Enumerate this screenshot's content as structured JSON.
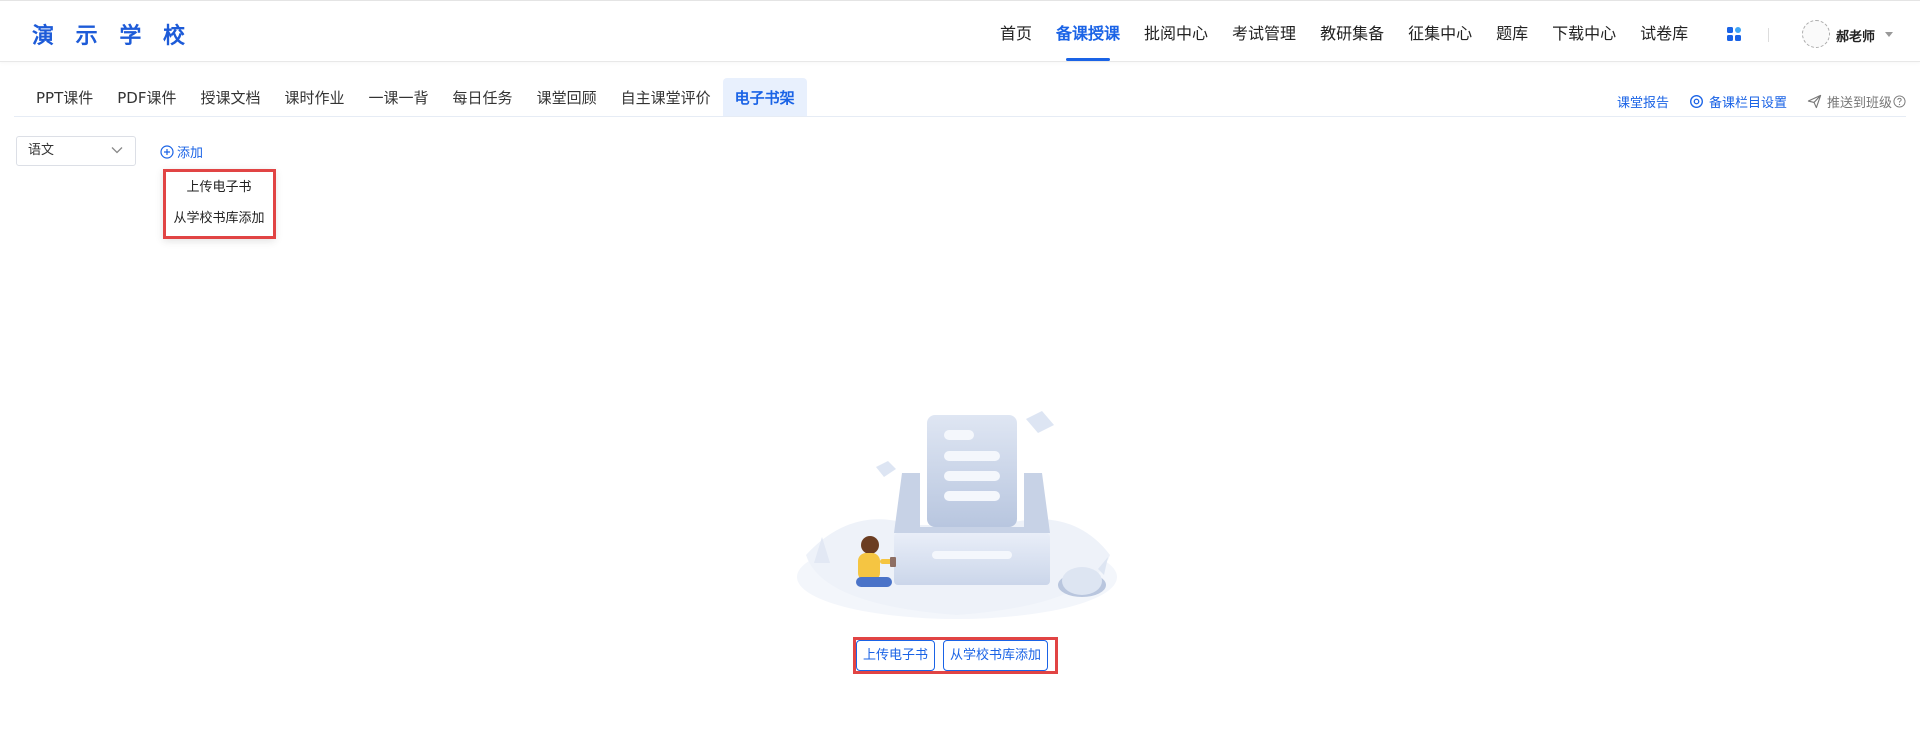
{
  "header": {
    "logo": "演 示 学 校",
    "nav": [
      {
        "label": "首页",
        "active": false
      },
      {
        "label": "备课授课",
        "active": true
      },
      {
        "label": "批阅中心",
        "active": false
      },
      {
        "label": "考试管理",
        "active": false
      },
      {
        "label": "教研集备",
        "active": false
      },
      {
        "label": "征集中心",
        "active": false
      },
      {
        "label": "题库",
        "active": false
      },
      {
        "label": "下载中心",
        "active": false
      },
      {
        "label": "试卷库",
        "active": false
      }
    ],
    "apps_icon": "grid-apps-icon",
    "user": {
      "name": "郝老师",
      "avatar_icon": "avatar-icon"
    }
  },
  "subtabs": [
    {
      "label": "PPT课件",
      "active": false
    },
    {
      "label": "PDF课件",
      "active": false
    },
    {
      "label": "授课文档",
      "active": false
    },
    {
      "label": "课时作业",
      "active": false
    },
    {
      "label": "一课一背",
      "active": false
    },
    {
      "label": "每日任务",
      "active": false
    },
    {
      "label": "课堂回顾",
      "active": false
    },
    {
      "label": "自主课堂评价",
      "active": false
    },
    {
      "label": "电子书架",
      "active": true
    }
  ],
  "actions": {
    "report": "课堂报告",
    "settings": "备课栏目设置",
    "push": "推送到班级"
  },
  "toolbar": {
    "subject_value": "语文",
    "add_label": "添加"
  },
  "dropdown": {
    "items": [
      "上传电子书",
      "从学校书库添加"
    ]
  },
  "empty_state": {
    "upload_button": "上传电子书",
    "library_button": "从学校书库添加"
  },
  "colors": {
    "accent": "#1a63e6",
    "highlight": "#e14444"
  }
}
